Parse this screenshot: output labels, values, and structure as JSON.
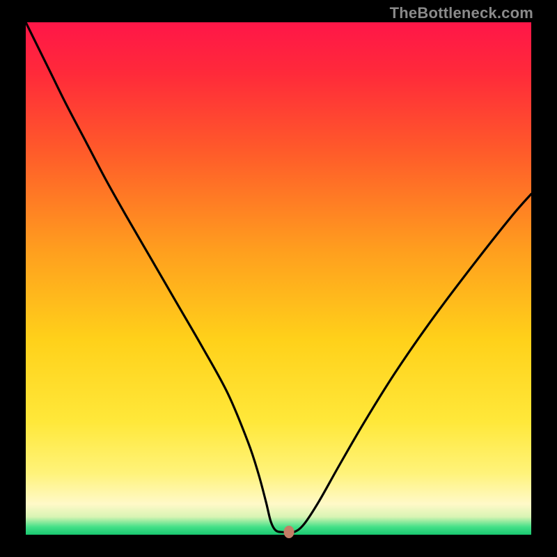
{
  "attribution": "TheBottleneck.com",
  "colors": {
    "background": "#000000",
    "gradient_stops": [
      {
        "pos": 0.0,
        "color": "#ff1648"
      },
      {
        "pos": 0.1,
        "color": "#ff2a3a"
      },
      {
        "pos": 0.25,
        "color": "#ff5a2a"
      },
      {
        "pos": 0.45,
        "color": "#ffa01e"
      },
      {
        "pos": 0.62,
        "color": "#ffd11a"
      },
      {
        "pos": 0.78,
        "color": "#ffe83a"
      },
      {
        "pos": 0.88,
        "color": "#fff37a"
      },
      {
        "pos": 0.94,
        "color": "#fff9c8"
      },
      {
        "pos": 0.965,
        "color": "#d9f4b4"
      },
      {
        "pos": 0.985,
        "color": "#43e087"
      },
      {
        "pos": 1.0,
        "color": "#18c870"
      }
    ],
    "curve": "#000000",
    "marker": "#c47d66"
  },
  "chart_data": {
    "type": "line",
    "title": "",
    "xlabel": "",
    "ylabel": "",
    "xlim": [
      0,
      100
    ],
    "ylim": [
      0,
      100
    ],
    "series": [
      {
        "name": "bottleneck-curve",
        "x": [
          0,
          2,
          5,
          8,
          12,
          16,
          20,
          25,
          30,
          35,
          40,
          44,
          46,
          47.5,
          48.5,
          49.5,
          51,
          53,
          55,
          58,
          62,
          67,
          73,
          80,
          88,
          96,
          100
        ],
        "y": [
          100,
          96,
          90,
          84,
          76.5,
          69,
          62,
          53.5,
          45,
          36.5,
          27.5,
          18,
          12,
          6.5,
          2.5,
          0.8,
          0.5,
          0.5,
          2,
          6.5,
          13.5,
          22,
          31.5,
          41.5,
          52,
          62,
          66.5
        ]
      }
    ],
    "annotations": [
      {
        "name": "optimal-point",
        "x": 52,
        "y": 0.5
      }
    ]
  }
}
